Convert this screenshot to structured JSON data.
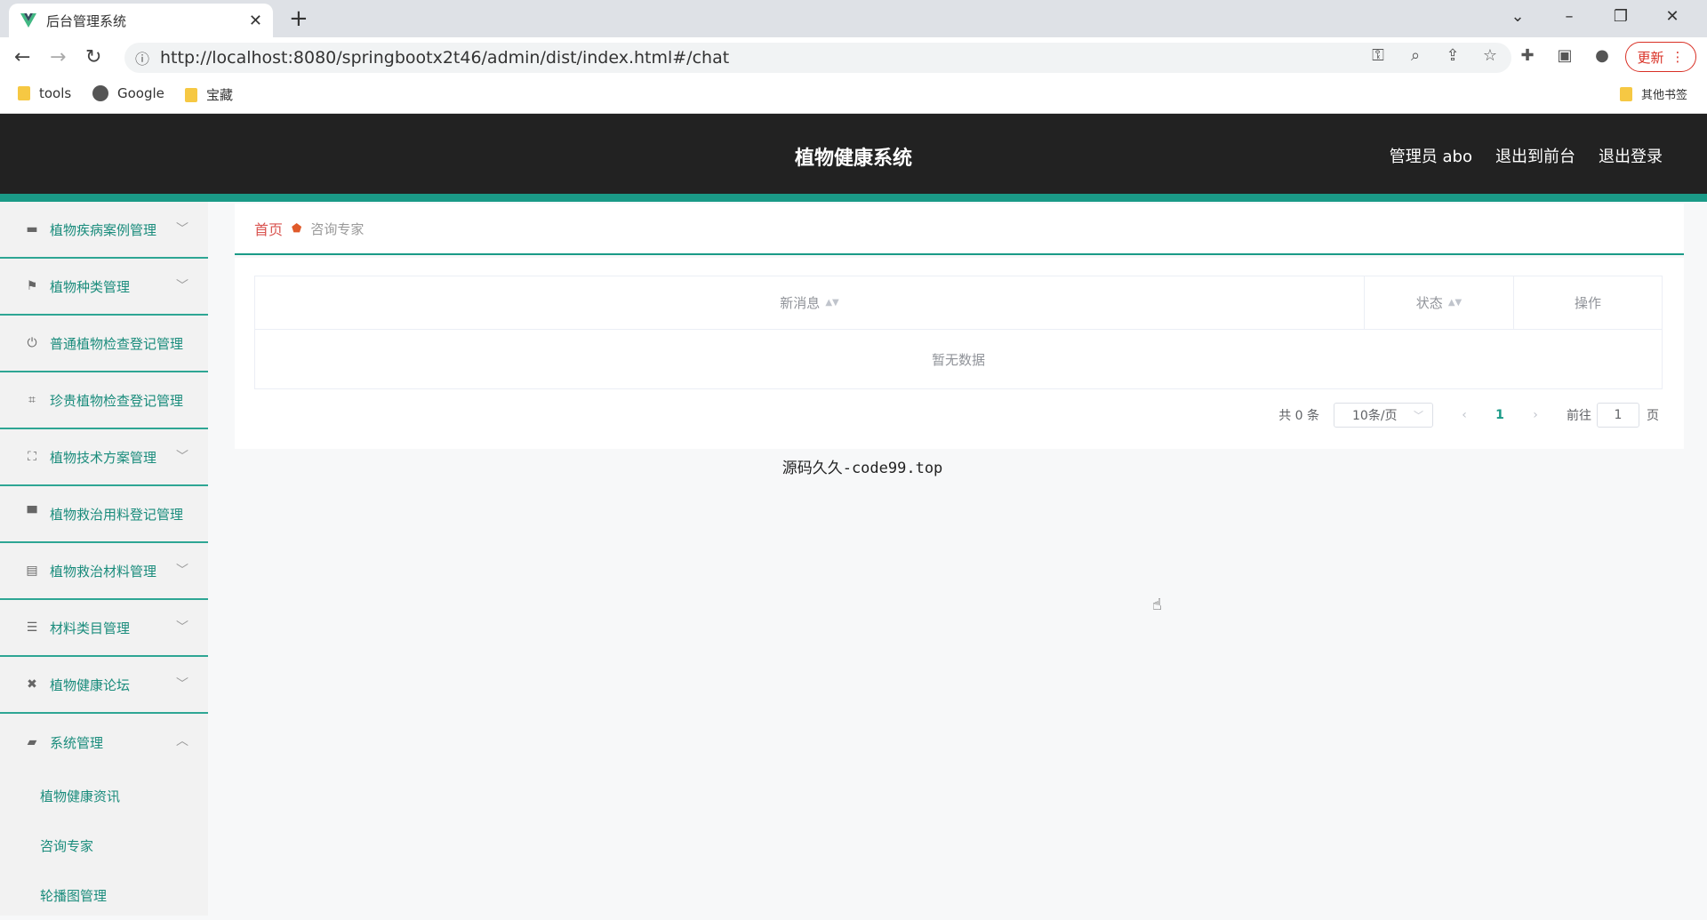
{
  "browser": {
    "tab_title": "后台管理系统",
    "url": "http://localhost:8080/springbootx2t46/admin/dist/index.html#/chat",
    "update_label": "更新",
    "bookmarks": [
      "tools",
      "Google",
      "宝藏"
    ],
    "other_bookmarks": "其他书签"
  },
  "header": {
    "title": "植物健康系统",
    "user": "管理员 abo",
    "to_front": "退出到前台",
    "logout": "退出登录"
  },
  "sidebar": {
    "items": [
      {
        "label": "植物疾病案例管理",
        "icon": "briefcase-icon"
      },
      {
        "label": "植物种类管理",
        "icon": "flag-icon"
      },
      {
        "label": "普通植物检查登记管理",
        "icon": "power-icon"
      },
      {
        "label": "珍贵植物检查登记管理",
        "icon": "crop-icon"
      },
      {
        "label": "植物技术方案管理",
        "icon": "fullscreen-icon"
      },
      {
        "label": "植物救治用料登记管理",
        "icon": "monitor-icon"
      },
      {
        "label": "植物救治材料管理",
        "icon": "clipboard-icon"
      },
      {
        "label": "材料类目管理",
        "icon": "sliders-icon"
      },
      {
        "label": "植物健康论坛",
        "icon": "ticket-icon"
      },
      {
        "label": "系统管理",
        "icon": "chat-icon"
      }
    ],
    "subitems": [
      "植物健康资讯",
      "咨询专家",
      "轮播图管理"
    ]
  },
  "breadcrumb": {
    "home": "首页",
    "current": "咨询专家"
  },
  "table": {
    "columns": [
      "新消息",
      "状态",
      "操作"
    ],
    "empty_text": "暂无数据"
  },
  "pagination": {
    "total": "共 0 条",
    "page_size": "10条/页",
    "current_page": "1",
    "goto_label": "前往",
    "goto_value": "1",
    "page_suffix": "页"
  },
  "footer_note": "源码久久-code99.top",
  "colors": {
    "accent": "#1a9a87",
    "header_bg": "#222222",
    "home_link": "#d9534f"
  }
}
